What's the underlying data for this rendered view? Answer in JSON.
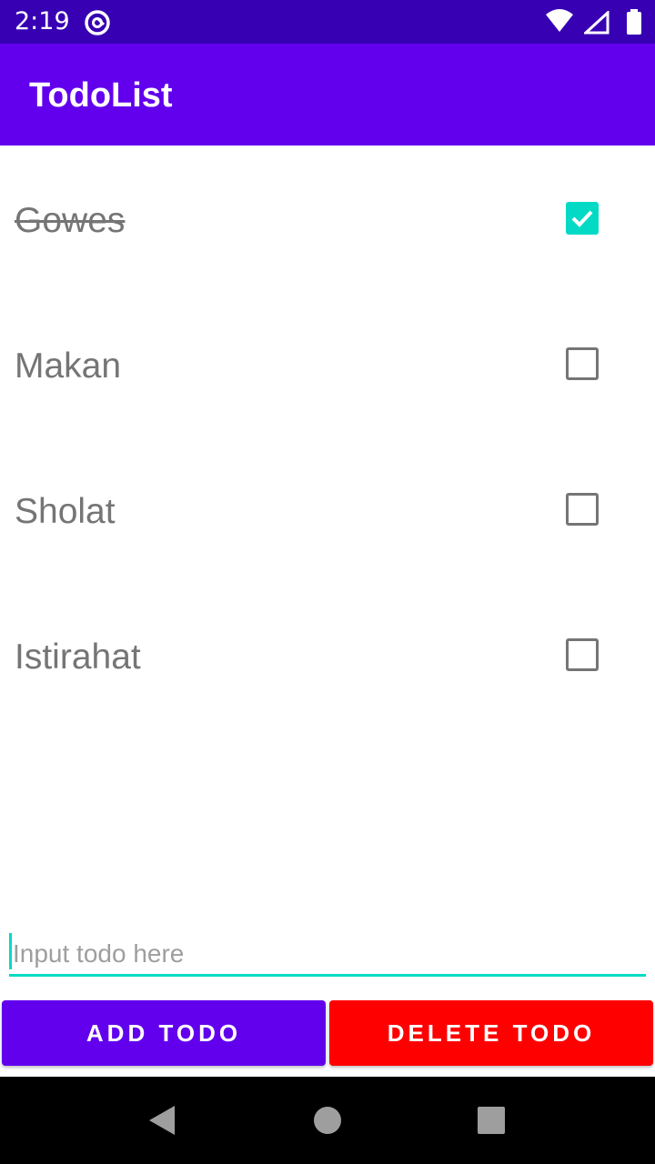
{
  "status_bar": {
    "time": "2:19"
  },
  "app_bar": {
    "title": "TodoList"
  },
  "todos": [
    {
      "label": "Gowes",
      "checked": true
    },
    {
      "label": "Makan",
      "checked": false
    },
    {
      "label": "Sholat",
      "checked": false
    },
    {
      "label": "Istirahat",
      "checked": false
    }
  ],
  "input": {
    "value": "",
    "placeholder": "Input todo here"
  },
  "buttons": {
    "add_label": "ADD TODO",
    "delete_label": "DELETE TODO"
  },
  "icons": {
    "status_app": "at-sign-icon",
    "wifi": "wifi-icon",
    "signal": "signal-icon",
    "battery": "battery-icon",
    "nav_back": "back-triangle-icon",
    "nav_home": "home-circle-icon",
    "nav_recent": "recent-square-icon"
  },
  "colors": {
    "status_bar": "#3700b3",
    "primary": "#6200ee",
    "accent": "#03dac5",
    "delete": "#ff0000",
    "todo_text": "#757575"
  }
}
